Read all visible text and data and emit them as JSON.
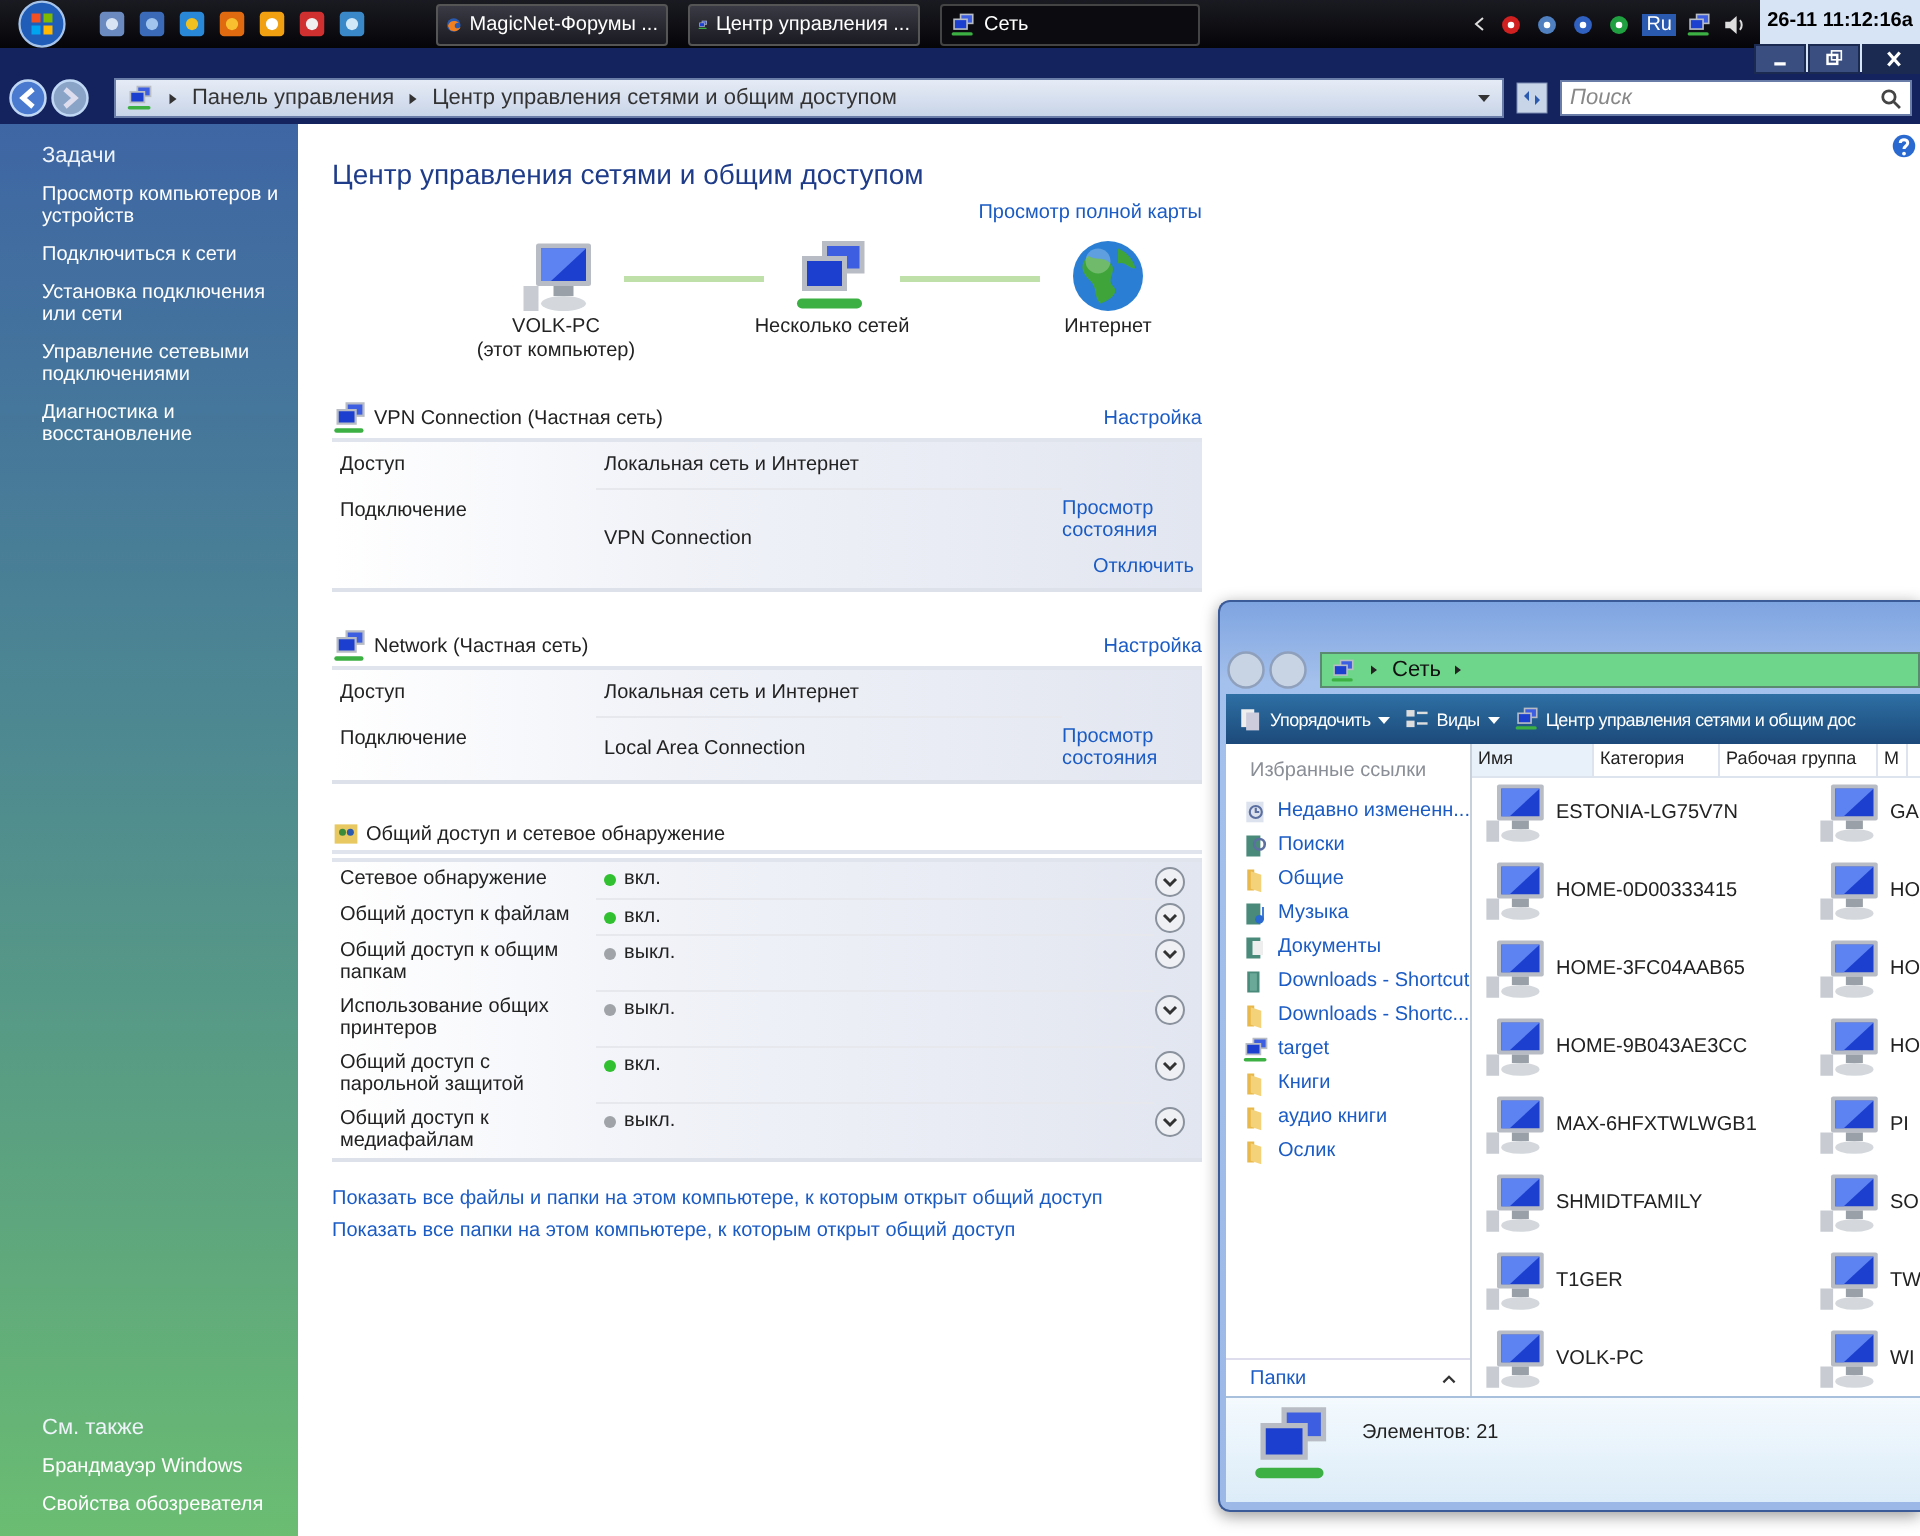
{
  "taskbar": {
    "tasks": [
      {
        "label": "MagicNet-Форумы ...",
        "selected": false,
        "kind": "browser"
      },
      {
        "label": "Центр управления ...",
        "selected": false,
        "kind": "network"
      },
      {
        "label": "Сеть",
        "selected": true,
        "kind": "network"
      }
    ],
    "language": "Ru",
    "clock": "26-11 11:12:16а"
  },
  "address_bar": {
    "breadcrumb": [
      "Панель управления",
      "Центр управления сетями и общим доступом"
    ],
    "search": {
      "placeholder": "Поиск"
    }
  },
  "sidebar": {
    "heading": "Задачи",
    "items": [
      "Просмотр компьютеров и устройств",
      "Подключиться к сети",
      "Установка подключения или сети",
      "Управление сетевыми подключениями",
      "Диагностика и восстановление"
    ],
    "see_also": {
      "heading": "См. также",
      "items": [
        "Брандмауэр Windows",
        "Свойства обозревателя"
      ]
    }
  },
  "main": {
    "title": "Центр управления сетями и общим доступом",
    "full_map_link": "Просмотр полной карты",
    "map": [
      {
        "name": "VOLK-PC",
        "note": "(этот компьютер)",
        "kind": "computer"
      },
      {
        "name": "Несколько сетей",
        "kind": "network"
      },
      {
        "name": "Интернет",
        "kind": "globe"
      }
    ],
    "networks": [
      {
        "name": "VPN Connection (Частная сеть)",
        "settings": "Настройка",
        "rows": [
          {
            "label": "Доступ",
            "value": "Локальная сеть и Интернет"
          },
          {
            "label": "Подключение",
            "value": "VPN Connection",
            "links": [
              "Просмотр состояния",
              "Отключить"
            ]
          }
        ]
      },
      {
        "name": "Network (Частная сеть)",
        "settings": "Настройка",
        "rows": [
          {
            "label": "Доступ",
            "value": "Локальная сеть и Интернет"
          },
          {
            "label": "Подключение",
            "value": "Local Area Connection",
            "links": [
              "Просмотр состояния"
            ]
          }
        ]
      }
    ],
    "sharing": {
      "title": "Общий доступ и сетевое обнаружение",
      "items": [
        {
          "label": "Сетевое обнаружение",
          "status": "вкл.",
          "on": true
        },
        {
          "label": "Общий доступ к файлам",
          "status": "вкл.",
          "on": true
        },
        {
          "label": "Общий доступ к общим папкам",
          "status": "выкл.",
          "on": false
        },
        {
          "label": "Использование общих принтеров",
          "status": "выкл.",
          "on": false
        },
        {
          "label": "Общий доступ с парольной защитой",
          "status": "вкл.",
          "on": true
        },
        {
          "label": "Общий доступ к медиафайлам",
          "status": "выкл.",
          "on": false
        }
      ]
    },
    "links": [
      "Показать все файлы и папки на этом компьютере, к которым открыт общий доступ",
      "Показать все папки на этом компьютере, к которым открыт общий доступ"
    ]
  },
  "explorer": {
    "breadcrumb": [
      "Сеть"
    ],
    "toolbar": [
      {
        "label": "Упорядочить",
        "kind": "organize"
      },
      {
        "label": "Виды",
        "kind": "views"
      },
      {
        "label": "Центр управления сетями и общим дос",
        "kind": "network"
      }
    ],
    "favorites_heading": "Избранные ссылки",
    "favorites": [
      {
        "label": "Недавно измененн...",
        "kind": "recent"
      },
      {
        "label": "Поиски",
        "kind": "search"
      },
      {
        "label": "Общие",
        "kind": "folder"
      },
      {
        "label": "Музыка",
        "kind": "music"
      },
      {
        "label": "Документы",
        "kind": "documents"
      },
      {
        "label": "Downloads - Shortcut",
        "kind": "shortcut"
      },
      {
        "label": "Downloads - Shortc...",
        "kind": "folder"
      },
      {
        "label": "target",
        "kind": "network"
      },
      {
        "label": "Книги",
        "kind": "folder"
      },
      {
        "label": "аудио книги",
        "kind": "folder"
      },
      {
        "label": "Ослик",
        "kind": "folder"
      }
    ],
    "folders_label": "Папки",
    "columns": [
      "Имя",
      "Категория",
      "Рабочая группа",
      "М"
    ],
    "items": [
      "ESTONIA-LG75V7N",
      "GA",
      "HOME-0D00333415",
      "HO",
      "HOME-3FC04AAB65",
      "HO",
      "HOME-9B043AE3CC",
      "HO",
      "MAX-6HFXTWLWGB1",
      "PI",
      "SHMIDTFAMILY",
      "SO",
      "T1GER",
      "TW",
      "VOLK-PC",
      "WI"
    ],
    "status": "Элементов: 21"
  }
}
